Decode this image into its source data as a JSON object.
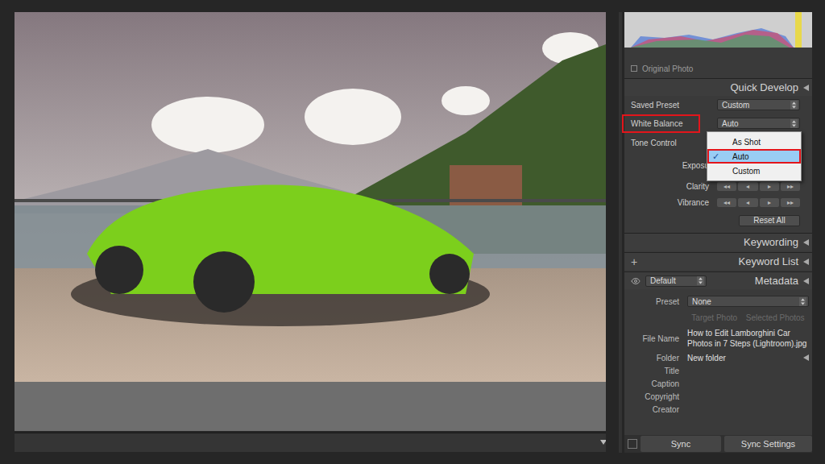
{
  "histogram": {
    "original_photo": {
      "label": "Original Photo",
      "checked": false
    }
  },
  "quick_develop": {
    "title": "Quick Develop",
    "rows": [
      {
        "kind": "select",
        "label": "Saved Preset",
        "value": "Custom",
        "highlighted": false,
        "open": false
      },
      {
        "kind": "select",
        "label": "White Balance",
        "value": "Auto",
        "highlighted": true,
        "open": true
      },
      {
        "kind": "heading",
        "label": "Tone Control"
      },
      {
        "kind": "stepper",
        "label": "Exposu",
        "buttons": []
      },
      {
        "kind": "stepper",
        "label": "Clarity",
        "buttons": [
          "◂◂",
          "◂",
          "▸",
          "▸▸"
        ]
      },
      {
        "kind": "stepper",
        "label": "Vibrance",
        "buttons": [
          "◂◂",
          "◂",
          "▸",
          "▸▸"
        ]
      }
    ],
    "reset_button": "Reset All"
  },
  "white_balance_menu": {
    "check": "✓",
    "items": [
      {
        "label": "As Shot",
        "selected": false,
        "highlighted": false
      },
      {
        "label": "Auto",
        "selected": true,
        "highlighted": true
      },
      {
        "label": "Custom",
        "selected": false,
        "highlighted": false
      }
    ]
  },
  "keywording": {
    "title": "Keywording"
  },
  "keyword_list": {
    "title": "Keyword List",
    "add": "+"
  },
  "metadata": {
    "title": "Metadata",
    "preset_select": "Default",
    "preset": {
      "label": "Preset",
      "value": "None"
    },
    "targets": [
      {
        "label": "Target Photo",
        "disabled": true
      },
      {
        "label": "Selected Photos",
        "disabled": true
      }
    ],
    "fields": [
      {
        "label": "File Name",
        "value": "How to Edit Lamborghini Car Photos in 7 Steps (Lightroom).jpg",
        "kind": "text"
      },
      {
        "label": "Folder",
        "value": "New folder",
        "kind": "folder"
      },
      {
        "label": "Title",
        "value": "",
        "kind": "text"
      },
      {
        "label": "Caption",
        "value": "",
        "kind": "text"
      },
      {
        "label": "Copyright",
        "value": "",
        "kind": "text"
      },
      {
        "label": "Creator",
        "value": "",
        "kind": "text"
      }
    ]
  },
  "sync": {
    "buttons": [
      "Sync",
      "Sync Settings"
    ]
  }
}
